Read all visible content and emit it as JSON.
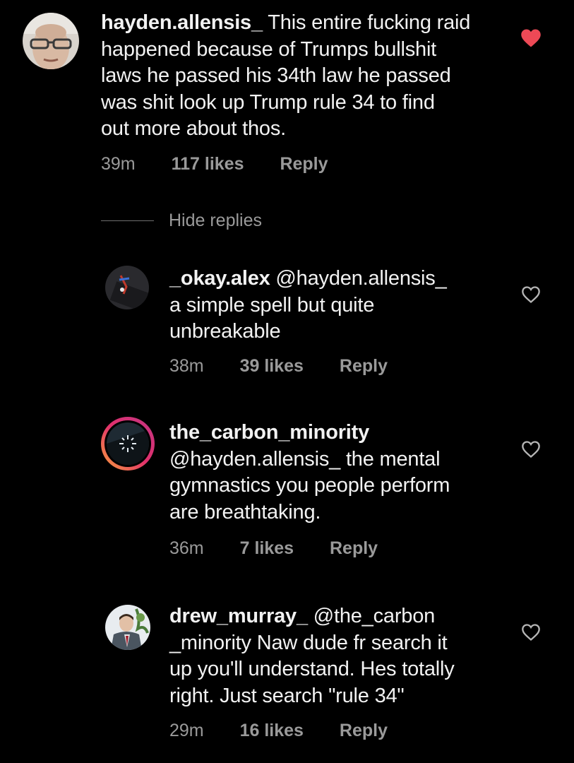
{
  "hide_replies_label": "Hide replies",
  "colors": {
    "background": "#000000",
    "text": "#f2f2f2",
    "meta": "#9a9a9a",
    "liked_heart": "#ed4956"
  },
  "comments": [
    {
      "username": "hayden.allensis_",
      "text": "This entire fucking raid happened because of Trumps bullshit laws he passed his 34th law he passed was shit look up Trump rule 34 to find out more about thos.",
      "lines": [
        " This entire fucking raid",
        "happened because of Trumps bullshit",
        "laws he passed his 34th law he passed",
        "was shit look up Trump rule 34 to find",
        "out more about thos."
      ],
      "time": "39m",
      "likes": "117 likes",
      "reply": "Reply",
      "liked": true,
      "heart_icon": "heart-filled-icon"
    },
    {
      "username": "_okay.alex",
      "text": "@hayden.allensis_ a simple spell but quite unbreakable",
      "lines": [
        " @hayden.allensis_",
        "a simple spell but quite",
        "unbreakable"
      ],
      "time": "38m",
      "likes": "39 likes",
      "reply": "Reply",
      "liked": false,
      "heart_icon": "heart-outline-icon"
    },
    {
      "username": "the_carbon_minority",
      "text": "@hayden.allensis_ the mental gymnastics you people perform are breathtaking.",
      "lines": [
        "",
        "@hayden.allensis_ the mental",
        "gymnastics you people perform",
        "are breathtaking."
      ],
      "time": "36m",
      "likes": "7 likes",
      "reply": "Reply",
      "liked": false,
      "heart_icon": "heart-outline-icon"
    },
    {
      "username": "drew_murray_",
      "text": "@the_carbon _minority Naw dude fr search it up you'll understand. Hes totally right. Just search \"rule 34\"",
      "lines": [
        " @the_carbon",
        "_minority Naw dude fr search it",
        "up you'll understand. Hes totally",
        "right. Just search \"rule 34\""
      ],
      "time": "29m",
      "likes": "16 likes",
      "reply": "Reply",
      "liked": false,
      "heart_icon": "heart-outline-icon"
    }
  ]
}
